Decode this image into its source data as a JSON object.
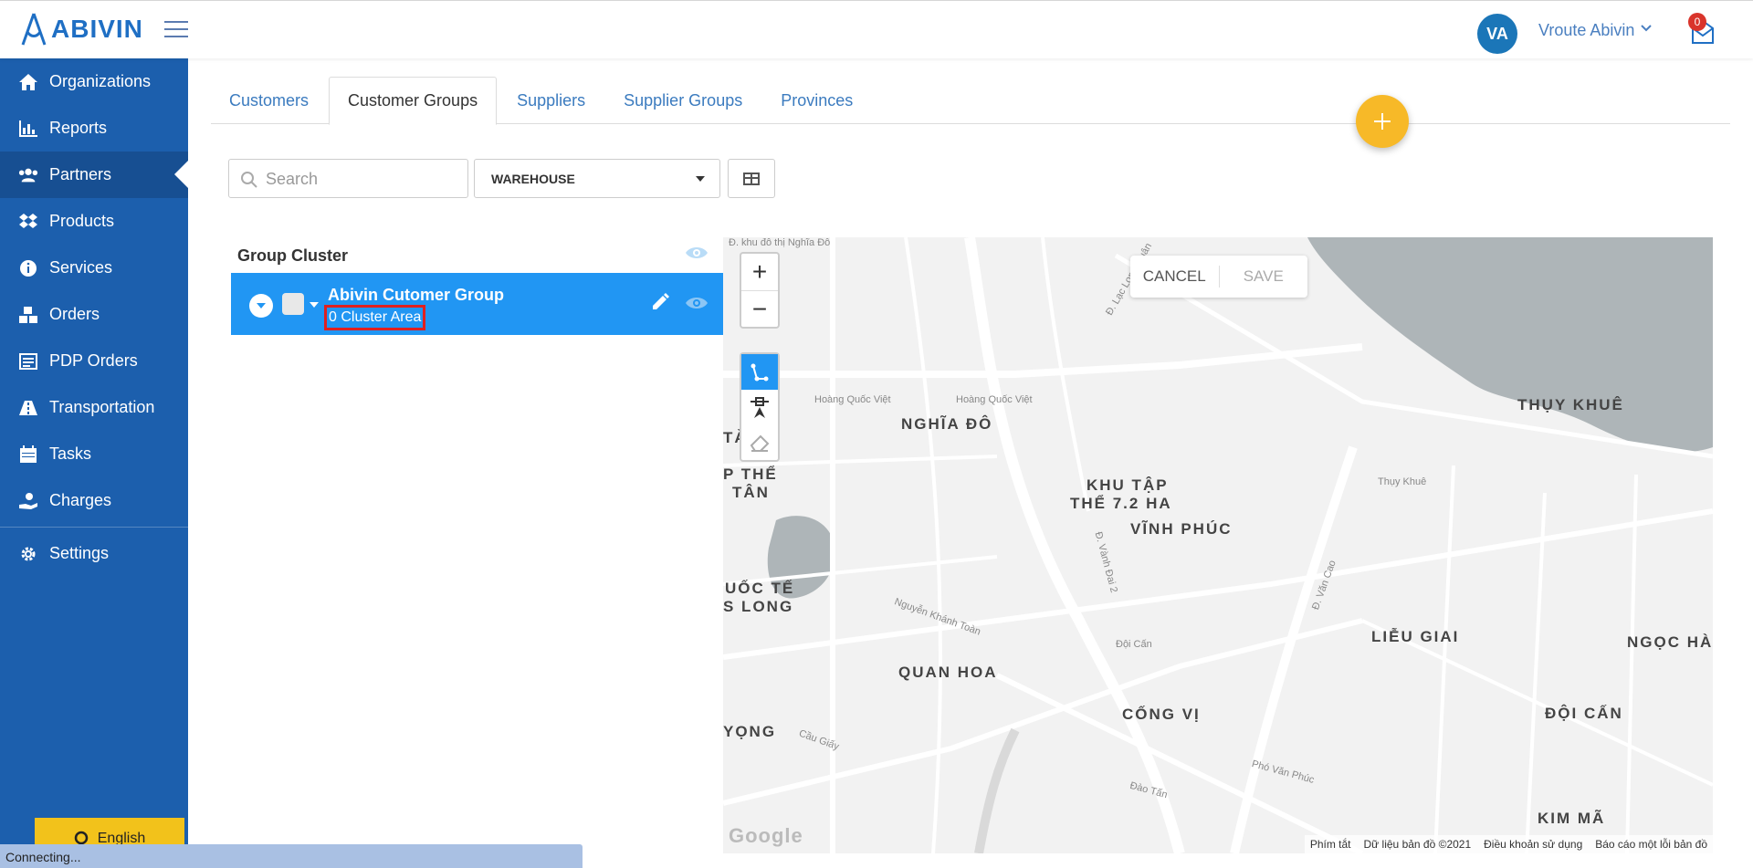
{
  "header": {
    "logo_text": "ABIVIN",
    "avatar_initials": "VA",
    "user_name": "Vroute Abivin",
    "notifications_count": "0"
  },
  "sidebar": {
    "items": [
      {
        "label": "Organizations",
        "icon": "home-icon"
      },
      {
        "label": "Reports",
        "icon": "bar-chart-icon"
      },
      {
        "label": "Partners",
        "icon": "users-icon"
      },
      {
        "label": "Products",
        "icon": "dropbox-icon"
      },
      {
        "label": "Services",
        "icon": "info-icon"
      },
      {
        "label": "Orders",
        "icon": "cubes-icon"
      },
      {
        "label": "PDP Orders",
        "icon": "list-icon"
      },
      {
        "label": "Transportation",
        "icon": "road-icon"
      },
      {
        "label": "Tasks",
        "icon": "calendar-icon"
      },
      {
        "label": "Charges",
        "icon": "hand-coin-icon"
      },
      {
        "label": "Settings",
        "icon": "gear-icon"
      }
    ],
    "active": "Partners",
    "language_label": "English"
  },
  "status_text": "Connecting...",
  "tabs": [
    {
      "label": "Customers"
    },
    {
      "label": "Customer Groups"
    },
    {
      "label": "Suppliers"
    },
    {
      "label": "Supplier Groups"
    },
    {
      "label": "Provinces"
    }
  ],
  "active_tab": "Customer Groups",
  "toolbar": {
    "search_placeholder": "Search",
    "search_value": "",
    "type_selected": "WAREHOUSE"
  },
  "group_panel": {
    "title": "Group Cluster",
    "groups": [
      {
        "name": "Abivin Cutomer Group",
        "cluster_count": "0 Cluster Area"
      }
    ]
  },
  "map": {
    "cancel_label": "CANCEL",
    "save_label": "SAVE",
    "zoom_in": "+",
    "zoom_out": "−",
    "area_labels": [
      "NGHĨA ĐÔ",
      "THỤY KHUÊ",
      "KHU TẬP",
      "THỂ 7.2 HA",
      "VĨNH PHÚC",
      "P THỂ",
      "TÂN",
      "UỐC TẾ",
      "S LONG",
      "LIỄU GIAI",
      "NGỌC HÀ",
      "QUAN HOA",
      "CỐNG VỊ",
      "ĐỘI CẤN",
      "YỌNG",
      "KIM MÃ",
      "TÀ"
    ],
    "street_labels": [
      "Hoàng Quốc Việt",
      "Hoàng Quốc Việt",
      "Thụy Khuê",
      "Nguyễn Khánh Toàn",
      "Cầu Giấy",
      "Đ. Văn Cao",
      "Đ. Vành Đai 2",
      "Đội Cấn",
      "Đào Tấn",
      "Phó Văn Phúc",
      "Đ. Lạc Long Quân",
      "Đ. khu đô thị Nghĩa Đô"
    ],
    "google_text": "Google",
    "attribution": [
      "Phím tắt",
      "Dữ liệu bản đồ ©2021",
      "Điều khoản sử dụng",
      "Báo cáo một lỗi bản đồ"
    ]
  },
  "colors": {
    "sidebar": "#1c5fad",
    "accent": "#2196f3",
    "fab": "#f7b928",
    "language_button": "#f2c21b",
    "highlight_border": "#e02020"
  }
}
